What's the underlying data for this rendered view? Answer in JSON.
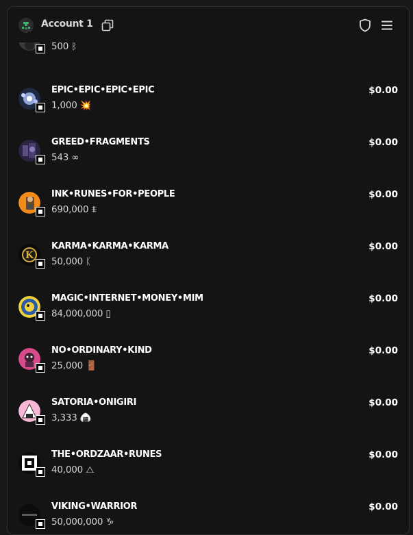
{
  "header": {
    "account_name": "Account 1"
  },
  "tokens": [
    {
      "name": "",
      "amount": "500",
      "symbol": "ᛒ",
      "value": ""
    },
    {
      "name": "EPIC•EPIC•EPIC•EPIC",
      "amount": "1,000",
      "symbol": "💥",
      "value": "$0.00"
    },
    {
      "name": "GREED•FRAGMENTS",
      "amount": "543",
      "symbol": "∞",
      "value": "$0.00"
    },
    {
      "name": "INK•RUNES•FOR•PEOPLE",
      "amount": "690,000",
      "symbol": "⩨",
      "value": "$0.00"
    },
    {
      "name": "KARMA•KARMA•KARMA",
      "amount": "50,000",
      "symbol": "ᛕ",
      "value": "$0.00"
    },
    {
      "name": "MAGIC•INTERNET•MONEY•MIM",
      "amount": "84,000,000",
      "symbol": "▯",
      "value": "$0.00"
    },
    {
      "name": "NO•ORDINARY•KIND",
      "amount": "25,000",
      "symbol": "🚪",
      "value": "$0.00"
    },
    {
      "name": "SATORIA•ONIGIRI",
      "amount": "3,333",
      "symbol": "🍙",
      "value": "$0.00"
    },
    {
      "name": "THE•ORDZAAR•RUNES",
      "amount": "40,000",
      "symbol": "⧍",
      "value": "$0.00"
    },
    {
      "name": "VIKING•WARRIOR",
      "amount": "50,000,000",
      "symbol": "♑",
      "value": "$0.00"
    }
  ],
  "icons": [
    "account-avatar-icon",
    "copy-icon",
    "shield-icon",
    "menu-icon",
    "inscription-badge-icon"
  ]
}
